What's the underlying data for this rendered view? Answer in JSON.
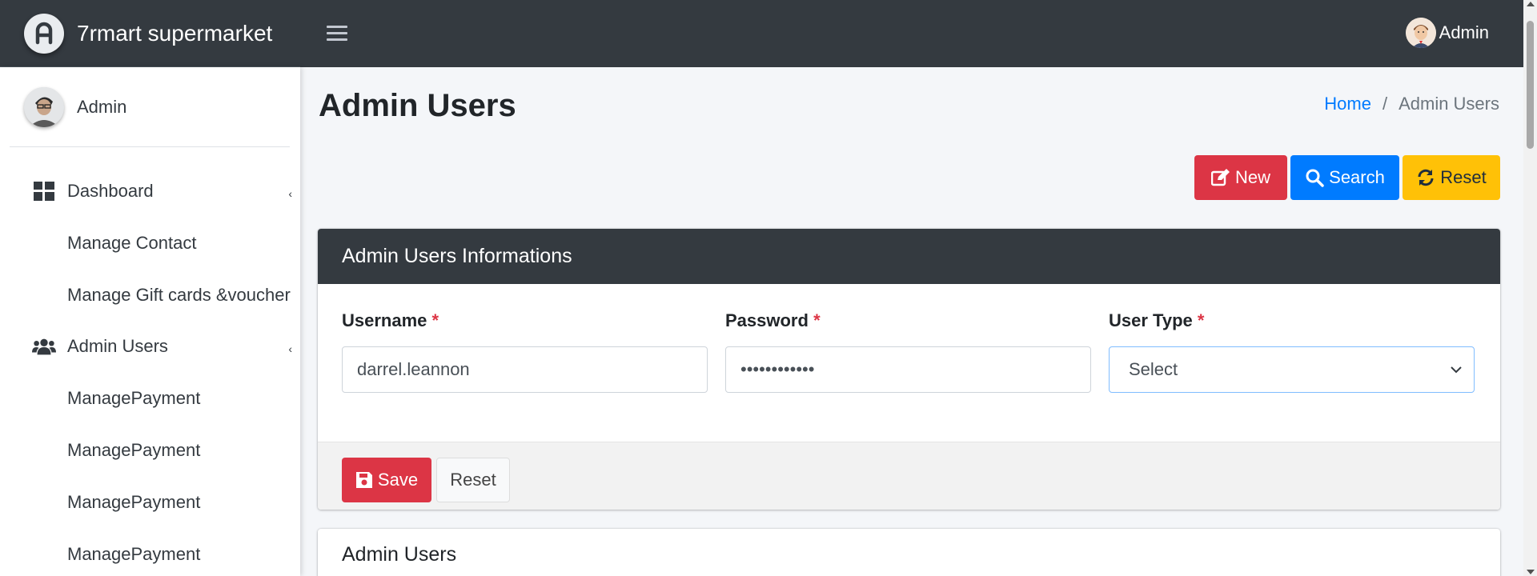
{
  "app": {
    "brand_name": "7rmart supermarket",
    "user_name": "Admin"
  },
  "sidebar": {
    "user_name": "Admin",
    "items": [
      {
        "label": "Dashboard",
        "icon": "dashboard-icon"
      },
      {
        "label": "Manage Contact"
      },
      {
        "label": "Manage Gift cards &voucher"
      },
      {
        "label": "Admin Users",
        "icon": "users-icon"
      },
      {
        "label": "ManagePayment"
      },
      {
        "label": "ManagePayment"
      },
      {
        "label": "ManagePayment"
      },
      {
        "label": "ManagePayment"
      }
    ]
  },
  "page": {
    "title": "Admin Users",
    "breadcrumb": {
      "home": "Home",
      "separator": "/",
      "current": "Admin Users"
    }
  },
  "toolbar": {
    "new_label": "New",
    "search_label": "Search",
    "reset_label": "Reset"
  },
  "form_card": {
    "title": "Admin Users Informations",
    "username": {
      "label": "Username",
      "required_mark": "*",
      "value": "darrel.leannon"
    },
    "password": {
      "label": "Password",
      "required_mark": "*",
      "value": "••••••••••••"
    },
    "user_type": {
      "label": "User Type",
      "required_mark": "*",
      "value": "Select"
    },
    "save_label": "Save",
    "reset_label": "Reset"
  },
  "list_card": {
    "title": "Admin Users"
  },
  "colors": {
    "header_bg": "#343a40",
    "danger": "#dc3545",
    "primary": "#007bff",
    "warning": "#ffc107"
  }
}
